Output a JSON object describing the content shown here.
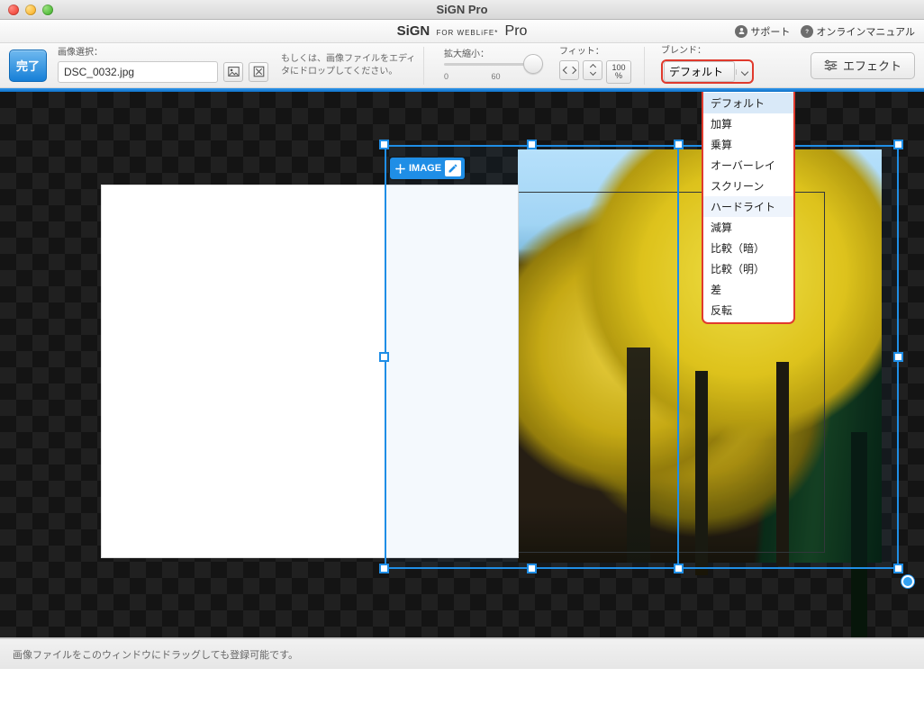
{
  "titlebar": {
    "title": "SiGN Pro"
  },
  "apphdr": {
    "logo": {
      "brand": "SiGN",
      "for": "FOR WEBLiFE*",
      "pro": "Pro"
    },
    "support": "サポート",
    "manual": "オンラインマニュアル"
  },
  "toolbar": {
    "done": "完了",
    "imgsel_label": "画像選択：",
    "imgsel_value": "DSC_0032.jpg",
    "hint": "もしくは、画像ファイルをエディタにドロップしてください。",
    "zoom_label": "拡大縮小：",
    "zoom_min": "0",
    "zoom_mid": "60",
    "fit_label": "フィット：",
    "pct_val": "100",
    "pct_sym": "%",
    "blend_label": "ブレンド：",
    "blend_selected": "デフォルト",
    "effect": "エフェクト"
  },
  "canvas": {
    "image_badge": "IMAGE"
  },
  "blend_menu": {
    "opts": [
      "デフォルト",
      "加算",
      "乗算",
      "オーバーレイ",
      "スクリーン",
      "ハードライト",
      "減算",
      "比較（暗）",
      "比較（明）",
      "差",
      "反転"
    ],
    "selected_index": 0,
    "hover_index": 5
  },
  "footer": {
    "text": "画像ファイルをこのウィンドウにドラッグしても登録可能です。"
  }
}
